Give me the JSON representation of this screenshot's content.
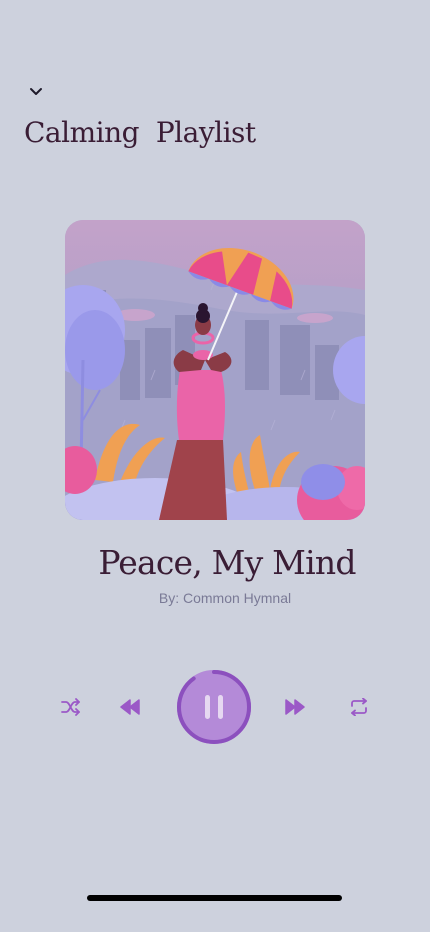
{
  "header": {
    "collapse_icon": "chevron-down-icon",
    "playlist_title": "Calming  Playlist"
  },
  "now_playing": {
    "artwork_description_icon": "album-art",
    "title": "Peace, My Mind",
    "artist": "By: Common Hymnal",
    "progress": 0.9
  },
  "controls": {
    "shuffle_icon": "shuffle-icon",
    "rewind_icon": "rewind-icon",
    "pause_icon": "pause-icon",
    "forward_icon": "fast-forward-icon",
    "repeat_icon": "repeat-icon"
  },
  "colors": {
    "background": "#cdd1dd",
    "text_dark": "#3a1d35",
    "accent_purple": "#b084d6",
    "accent_purple_dark": "#8f57c0",
    "artist_text": "#7a7a96"
  }
}
